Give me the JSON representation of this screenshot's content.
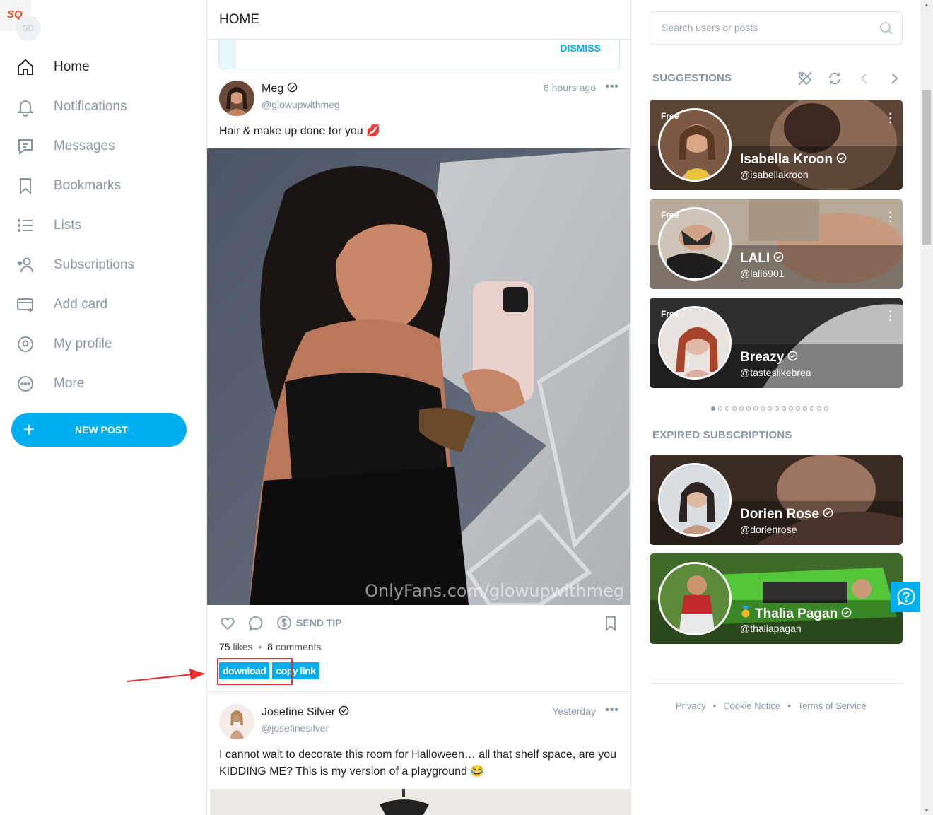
{
  "app": {
    "logo_text": "SQ",
    "avatar_initials": "SD"
  },
  "sidebar": {
    "items": [
      {
        "label": "Home",
        "icon": "home-icon"
      },
      {
        "label": "Notifications",
        "icon": "bell-icon"
      },
      {
        "label": "Messages",
        "icon": "message-icon"
      },
      {
        "label": "Bookmarks",
        "icon": "bookmark-icon"
      },
      {
        "label": "Lists",
        "icon": "list-icon"
      },
      {
        "label": "Subscriptions",
        "icon": "subscriptions-icon"
      },
      {
        "label": "Add card",
        "icon": "credit-card-icon"
      },
      {
        "label": "My profile",
        "icon": "profile-icon"
      },
      {
        "label": "More",
        "icon": "more-icon"
      }
    ],
    "new_post_label": "NEW POST"
  },
  "main": {
    "title": "HOME",
    "dismiss_label": "DISMISS",
    "posts": [
      {
        "name": "Meg",
        "handle": "@glowupwithmeg",
        "time": "8 hours ago",
        "text": "Hair & make up done for you 💋",
        "watermark": "OnlyFans.com/glowupwithmeg",
        "send_tip_label": "SEND TIP",
        "likes": "75",
        "likes_label": "likes",
        "comments": "8",
        "comments_label": "comments",
        "download_label": "download",
        "copy_link_label": "copy link"
      },
      {
        "name": "Josefine Silver",
        "handle": "@josefinesilver",
        "time": "Yesterday",
        "text": "I cannot wait to decorate this room for Halloween… all that shelf space, are you KIDDING ME? This is my version of a playground 😂"
      }
    ]
  },
  "right": {
    "search_placeholder": "Search users or posts",
    "suggestions_title": "SUGGESTIONS",
    "suggestions": [
      {
        "name": "Isabella Kroon",
        "handle": "@isabellakroon",
        "tag": "Free"
      },
      {
        "name": "LALI",
        "handle": "@lali6901",
        "tag": "Free"
      },
      {
        "name": "Breazy",
        "handle": "@tasteslikebrea",
        "tag": "Free"
      }
    ],
    "carousel_pages": 17,
    "carousel_active": 1,
    "expired_title": "EXPIRED SUBSCRIPTIONS",
    "expired": [
      {
        "name": "Dorien Rose",
        "handle": "@dorienrose"
      },
      {
        "name": "Thalia Pagan",
        "handle": "@thaliapagan",
        "prefix_icon": "medal-icon"
      }
    ],
    "footer": {
      "privacy": "Privacy",
      "cookie": "Cookie Notice",
      "terms": "Terms of Service",
      "separator": "•"
    }
  },
  "colors": {
    "accent": "#00aff0",
    "muted": "#8a96a3",
    "annotation": "#e53030"
  }
}
